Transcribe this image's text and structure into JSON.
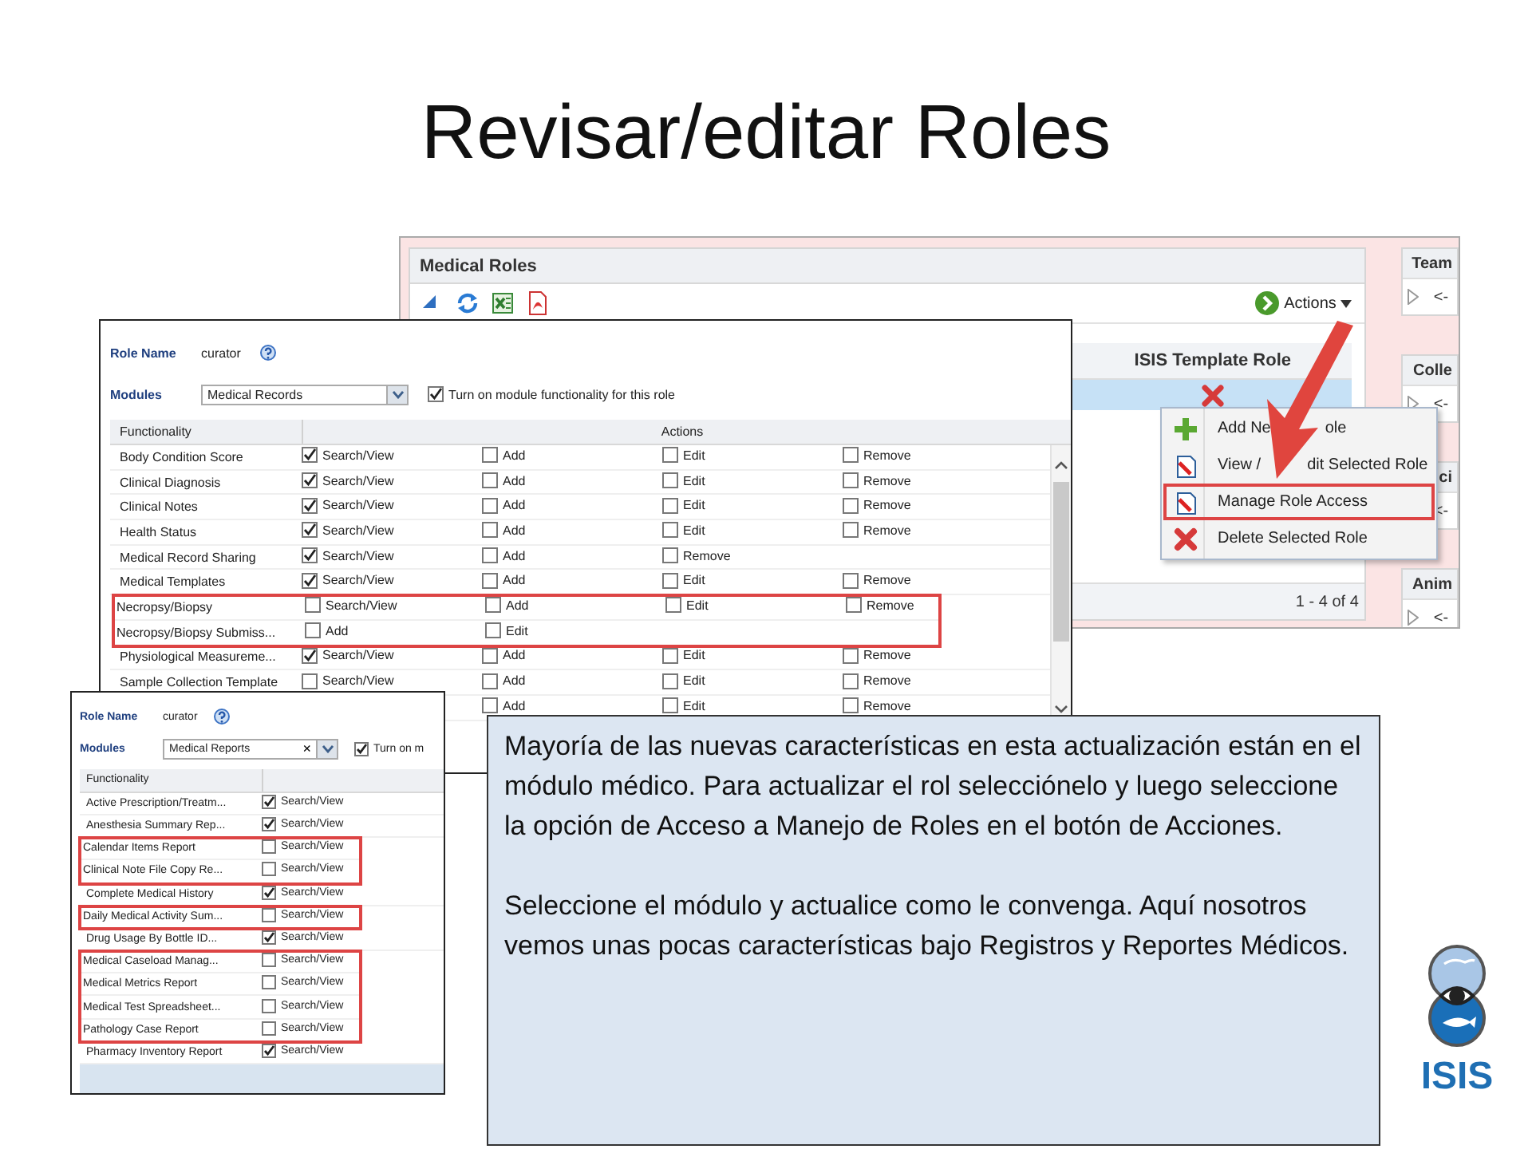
{
  "slide_title": "Revisar/editar Roles",
  "roles_panel": {
    "title": "Medical Roles",
    "actions_button": "Actions",
    "column_header": "ISIS Template Role",
    "rows": [
      {
        "selected": true,
        "is_template": false
      }
    ],
    "pager": "1 - 4 of 4",
    "side_panels": [
      {
        "title": "Team",
        "row": "<-",
        "expand_icon": true
      },
      {
        "title": "Colle",
        "row": "<-",
        "expand_icon": true
      },
      {
        "title": "ci",
        "row": "<-"
      },
      {
        "title": "Anim",
        "row": "<-",
        "expand_icon": true
      }
    ]
  },
  "context_menu": [
    {
      "label": [
        "Add Ne",
        "ole"
      ],
      "kind": "add",
      "highlighted": false
    },
    {
      "label": [
        "View /",
        "dit Selected Role"
      ],
      "kind": "edit",
      "highlighted": false
    },
    {
      "label": [
        "Manage Role Access"
      ],
      "kind": "edit",
      "highlighted": true
    },
    {
      "label": [
        "Delete Selected Role"
      ],
      "kind": "delete",
      "highlighted": false
    }
  ],
  "records_dialog": {
    "role_name_label": "Role Name",
    "role_name": "curator",
    "modules_label": "Modules",
    "module": "Medical Records",
    "module_toggle": {
      "label": "Turn on module functionality for this role",
      "checked": true
    },
    "columns": [
      "Functionality",
      "Actions"
    ],
    "rows": [
      {
        "label": "Body Condition Score",
        "highlighted": false,
        "actions": [
          {
            "label": "Search/View",
            "checked": true
          },
          {
            "label": "Add",
            "checked": false
          },
          {
            "label": "Edit",
            "checked": false
          },
          {
            "label": "Remove",
            "checked": false
          }
        ]
      },
      {
        "label": "Clinical Diagnosis",
        "highlighted": false,
        "actions": [
          {
            "label": "Search/View",
            "checked": true
          },
          {
            "label": "Add",
            "checked": false
          },
          {
            "label": "Edit",
            "checked": false
          },
          {
            "label": "Remove",
            "checked": false
          }
        ]
      },
      {
        "label": "Clinical Notes",
        "highlighted": false,
        "actions": [
          {
            "label": "Search/View",
            "checked": true
          },
          {
            "label": "Add",
            "checked": false
          },
          {
            "label": "Edit",
            "checked": false
          },
          {
            "label": "Remove",
            "checked": false
          }
        ]
      },
      {
        "label": "Health Status",
        "highlighted": false,
        "actions": [
          {
            "label": "Search/View",
            "checked": true
          },
          {
            "label": "Add",
            "checked": false
          },
          {
            "label": "Edit",
            "checked": false
          },
          {
            "label": "Remove",
            "checked": false
          }
        ]
      },
      {
        "label": "Medical Record Sharing",
        "highlighted": false,
        "actions": [
          {
            "label": "Search/View",
            "checked": true
          },
          {
            "label": "Add",
            "checked": false
          },
          {
            "label": "Remove",
            "checked": false
          }
        ]
      },
      {
        "label": "Medical Templates",
        "highlighted": false,
        "actions": [
          {
            "label": "Search/View",
            "checked": true
          },
          {
            "label": "Add",
            "checked": false
          },
          {
            "label": "Edit",
            "checked": false
          },
          {
            "label": "Remove",
            "checked": false
          }
        ]
      },
      {
        "label": "Necropsy/Biopsy",
        "highlighted": true,
        "actions": [
          {
            "label": "Search/View",
            "checked": false
          },
          {
            "label": "Add",
            "checked": false
          },
          {
            "label": "Edit",
            "checked": false
          },
          {
            "label": "Remove",
            "checked": false
          }
        ]
      },
      {
        "label": "Necropsy/Biopsy Submiss...",
        "highlighted": true,
        "actions": [
          {
            "label": "Add",
            "checked": false
          },
          {
            "label": "Edit",
            "checked": false
          }
        ]
      },
      {
        "label": "Physiological Measureme...",
        "highlighted": false,
        "actions": [
          {
            "label": "Search/View",
            "checked": true
          },
          {
            "label": "Add",
            "checked": false
          },
          {
            "label": "Edit",
            "checked": false
          },
          {
            "label": "Remove",
            "checked": false
          }
        ]
      },
      {
        "label": "Sample Collection Template",
        "highlighted": false,
        "actions": [
          {
            "label": "Search/View",
            "checked": false
          },
          {
            "label": "Add",
            "checked": false
          },
          {
            "label": "Edit",
            "checked": false
          },
          {
            "label": "Remove",
            "checked": false
          }
        ]
      },
      {
        "actions": [
          {
            "label": "Add",
            "checked": false
          },
          {
            "label": "Edit",
            "checked": false
          },
          {
            "label": "Remove",
            "checked": false
          }
        ]
      }
    ]
  },
  "reports_dialog": {
    "role_name_label": "Role Name",
    "role_name": "curator",
    "modules_label": "Modules",
    "module": "Medical Reports",
    "clear_button": "×",
    "module_toggle": {
      "label": "Turn on m",
      "checked": true
    },
    "columns": [
      "Functionality"
    ],
    "rows": [
      {
        "label": "Active Prescription/Treatm...",
        "highlighted": false,
        "actions": [
          {
            "label": "Search/View",
            "checked": true
          }
        ]
      },
      {
        "label": "Anesthesia Summary Rep...",
        "highlighted": false,
        "actions": [
          {
            "label": "Search/View",
            "checked": true
          }
        ]
      },
      {
        "label": "Calendar Items Report",
        "highlighted": true,
        "actions": [
          {
            "label": "Search/View",
            "checked": false
          }
        ]
      },
      {
        "label": "Clinical Note File Copy Re...",
        "highlighted": true,
        "actions": [
          {
            "label": "Search/View",
            "checked": false
          }
        ]
      },
      {
        "label": "Complete Medical History",
        "highlighted": false,
        "actions": [
          {
            "label": "Search/View",
            "checked": true
          }
        ]
      },
      {
        "label": "Daily Medical Activity Sum...",
        "highlighted": true,
        "actions": [
          {
            "label": "Search/View",
            "checked": false
          }
        ]
      },
      {
        "label": "Drug Usage By Bottle ID...",
        "highlighted": false,
        "actions": [
          {
            "label": "Search/View",
            "checked": true
          }
        ]
      },
      {
        "label": "Medical Caseload Manag...",
        "highlighted": true,
        "actions": [
          {
            "label": "Search/View",
            "checked": false
          }
        ]
      },
      {
        "label": "Medical Metrics Report",
        "highlighted": true,
        "actions": [
          {
            "label": "Search/View",
            "checked": false
          }
        ]
      },
      {
        "label": "Medical Test Spreadsheet...",
        "highlighted": true,
        "actions": [
          {
            "label": "Search/View",
            "checked": false
          }
        ]
      },
      {
        "label": "Pathology Case Report",
        "highlighted": true,
        "actions": [
          {
            "label": "Search/View",
            "checked": false
          }
        ]
      },
      {
        "label": "Pharmacy Inventory Report",
        "highlighted": false,
        "actions": [
          {
            "label": "Search/View",
            "checked": true
          }
        ]
      }
    ]
  },
  "note": [
    "Mayoría de las nuevas características en esta actualización están en el módulo médico. Para actualizar el rol selecciónelo y luego seleccione la opción de Acceso a Manejo de Roles en el botón de Acciones.",
    "Seleccione el módulo y actualice como le convenga. Aquí nosotros vemos unas pocas características bajo Registros y Reportes Médicos."
  ],
  "logo": {
    "text": "ISIS"
  }
}
